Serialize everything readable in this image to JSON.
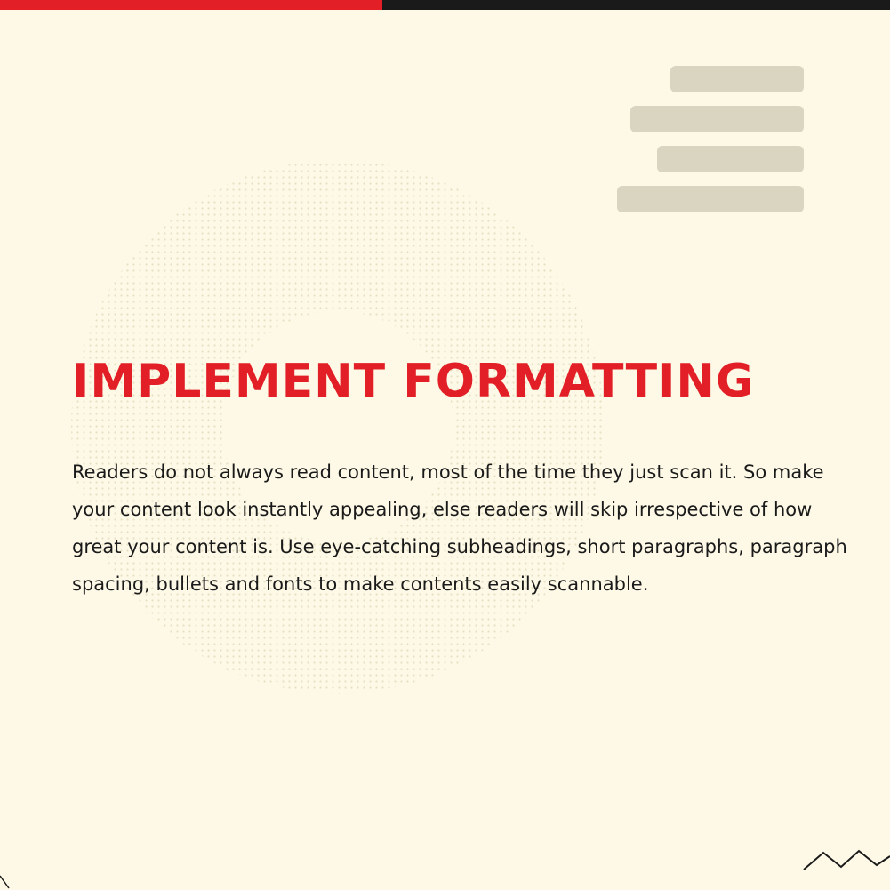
{
  "colors": {
    "background": "#fdf9e6",
    "accent_red": "#e21e26",
    "dark": "#1a1a1a",
    "decoration_gray": "#d9d5c0",
    "dots": "#e6e1c4"
  },
  "headline": "IMPLEMENT FORMATTING",
  "body": "Readers do not always read content, most of the time they just scan it. So make your content look instantly appealing, else readers will skip irrespective of how great your content is. Use eye-catching subheadings, short paragraphs, paragraph spacing, bullets and fonts to make contents easily scannable."
}
